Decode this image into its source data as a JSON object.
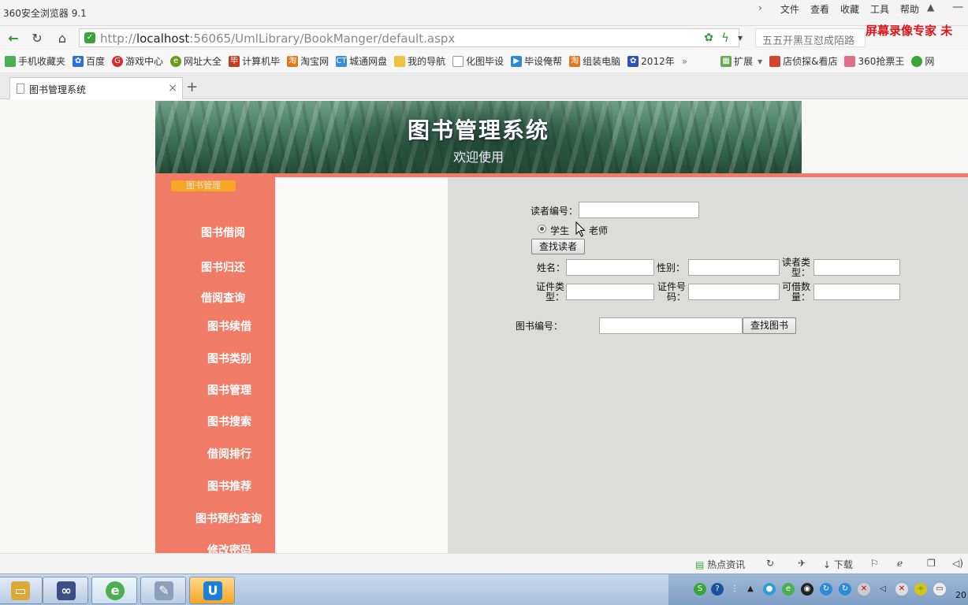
{
  "browser": {
    "app_title": "360安全浏览器 9.1",
    "menus": [
      "文件",
      "查看",
      "收藏",
      "工具",
      "帮助"
    ],
    "url_host_prefix": "http://",
    "url_host": "localhost",
    "url_rest": ":56065/UmlLibrary/BookManger/default.aspx",
    "search_placeholder": "五五开黑互怼成陌路",
    "recorder_text": "屏幕录像专家 未",
    "bookmarks": [
      "手机收藏夹",
      "百度",
      "游戏中心",
      "网址大全",
      "计算机毕",
      "淘宝网",
      "城通网盘",
      "我的导航",
      "化图毕设",
      "毕设俺帮",
      "组装电脑",
      "2012年",
      "»",
      "扩展",
      "店侦探&看店",
      "360抢票王",
      "网"
    ],
    "tab_label": "图书管理系统",
    "new_tab": "+",
    "tab_close": "×"
  },
  "banner": {
    "title": "图书管理系统",
    "subtitle": "欢迎使用"
  },
  "sidebar": {
    "user_label": "图书管理",
    "items": [
      "图书借阅",
      "图书归还",
      "借阅查询",
      "图书续借",
      "图书类别",
      "图书管理",
      "图书搜索",
      "借阅排行",
      "图书推荐",
      "图书预约查询",
      "修改密码"
    ]
  },
  "form": {
    "reader_id_label": "读者编号：",
    "reader_id_value": "",
    "radio_student": "学生",
    "radio_teacher": "老师",
    "selected_type": "学生",
    "find_reader_button": "查找读者",
    "name_label": "姓名：",
    "gender_label": "性别：",
    "reader_type_label_1": "读者类",
    "reader_type_label_2": "型：",
    "cert_type_label_1": "证件类",
    "cert_type_label_2": "型：",
    "cert_no_label_1": "证件号",
    "cert_no_label_2": "码：",
    "borrowable_label_1": "可借数",
    "borrowable_label_2": "量：",
    "book_id_label": "图书编号：",
    "find_book_button": "查找图书"
  },
  "statusbar": {
    "hot_news": "热点资讯",
    "download": "下载"
  },
  "taskbar": {
    "clock_fragment": "20"
  }
}
